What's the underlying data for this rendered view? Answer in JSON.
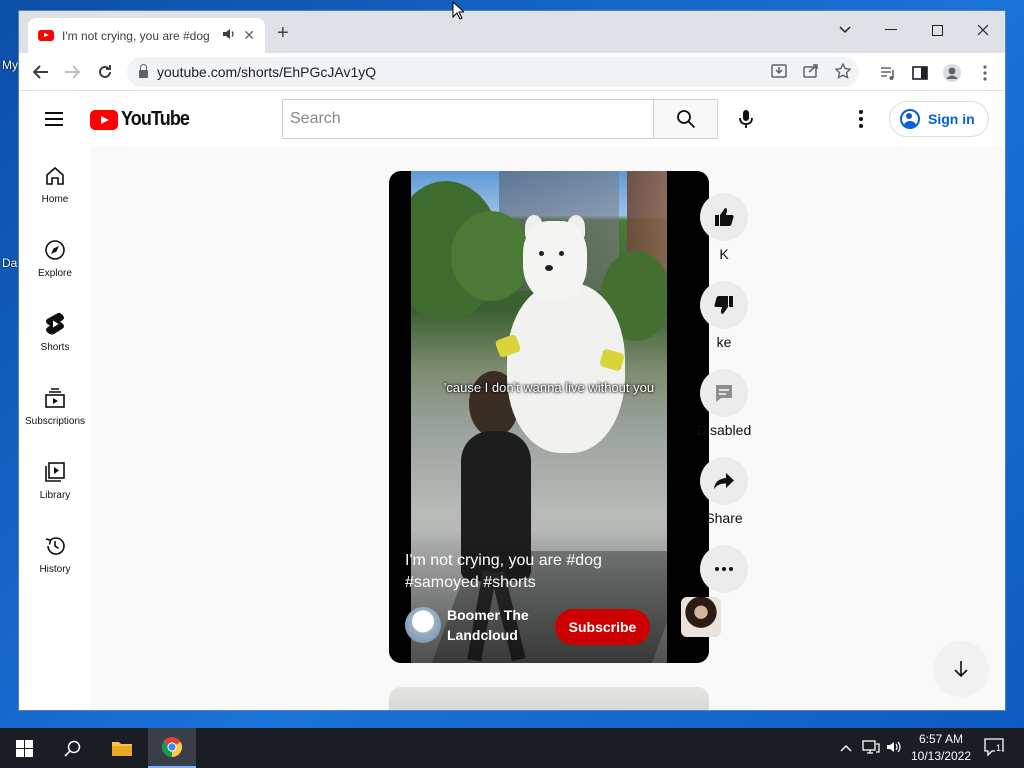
{
  "desktop": {
    "icon1_label": "My",
    "icon2_label": "Da"
  },
  "browser": {
    "tab": {
      "title": "I'm not crying, you are #dog"
    },
    "window_controls": {
      "minimize": "—",
      "maximize": "☐",
      "close": "✕",
      "tab_search": "⌄"
    },
    "address": {
      "url": "youtube.com/shorts/EhPGcJAv1yQ"
    }
  },
  "youtube": {
    "logo_text": "YouTube",
    "search": {
      "placeholder": "Search"
    },
    "signin_label": "Sign in",
    "guide": [
      {
        "label": "Home",
        "icon": "home-icon"
      },
      {
        "label": "Explore",
        "icon": "compass-icon"
      },
      {
        "label": "Shorts",
        "icon": "shorts-icon"
      },
      {
        "label": "Subscriptions",
        "icon": "subscriptions-icon"
      },
      {
        "label": "Library",
        "icon": "library-icon"
      },
      {
        "label": "History",
        "icon": "history-icon"
      }
    ],
    "short": {
      "subtitle": "'cause I don't wanna live without you",
      "title": "I'm not crying, you are #dog #samoyed #shorts",
      "channel": "Boomer The Landcloud",
      "subscribe_label": "Subscribe"
    },
    "actions": [
      {
        "label": "K",
        "icon": "like-icon"
      },
      {
        "label": "ke",
        "icon": "dislike-icon"
      },
      {
        "label": "Disabled",
        "icon": "comments-icon"
      },
      {
        "label": "Share",
        "icon": "share-icon"
      },
      {
        "label": "",
        "icon": "more-icon"
      }
    ]
  },
  "taskbar": {
    "time": "6:57 AM",
    "date": "10/13/2022",
    "notifications": "1"
  },
  "colors": {
    "brand_red": "#ff0000",
    "subscribe_red": "#cc0000",
    "link_blue": "#065fd4"
  }
}
